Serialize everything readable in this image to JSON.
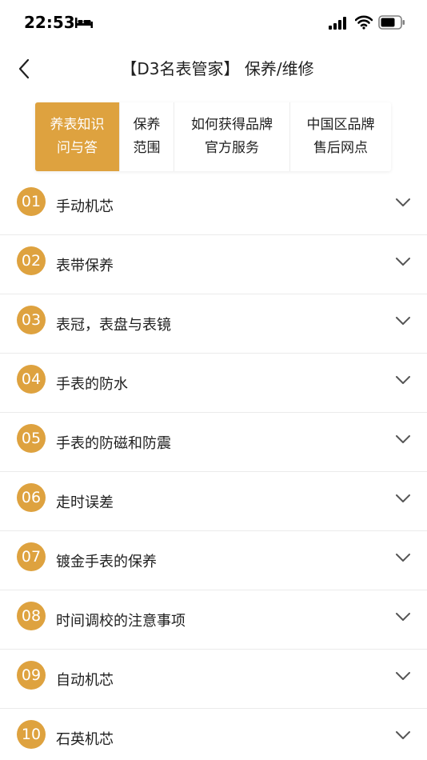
{
  "status_bar": {
    "time": "22:53"
  },
  "nav": {
    "title": "【D3名表管家】 保养/维修"
  },
  "tabs": [
    {
      "label": "养表知识\n问与答",
      "active": true
    },
    {
      "label": "保养\n范围",
      "active": false
    },
    {
      "label": "如何获得品牌\n官方服务",
      "active": false
    },
    {
      "label": "中国区品牌\n售后网点",
      "active": false
    }
  ],
  "items": [
    {
      "num": "01",
      "label": "手动机芯"
    },
    {
      "num": "02",
      "label": "表带保养"
    },
    {
      "num": "03",
      "label": "表冠，表盘与表镜"
    },
    {
      "num": "04",
      "label": "手表的防水"
    },
    {
      "num": "05",
      "label": "手表的防磁和防震"
    },
    {
      "num": "06",
      "label": "走时误差"
    },
    {
      "num": "07",
      "label": "镀金手表的保养"
    },
    {
      "num": "08",
      "label": "时间调校的注意事项"
    },
    {
      "num": "09",
      "label": "自动机芯"
    },
    {
      "num": "10",
      "label": "石英机芯"
    }
  ],
  "colors": {
    "accent": "#dea23f",
    "text": "#1f1f1f",
    "divider": "#ebebeb"
  },
  "icons": [
    "bed-icon",
    "signal-icon",
    "wifi-icon",
    "battery-icon",
    "back-arrow-icon",
    "chevron-down-icon"
  ]
}
